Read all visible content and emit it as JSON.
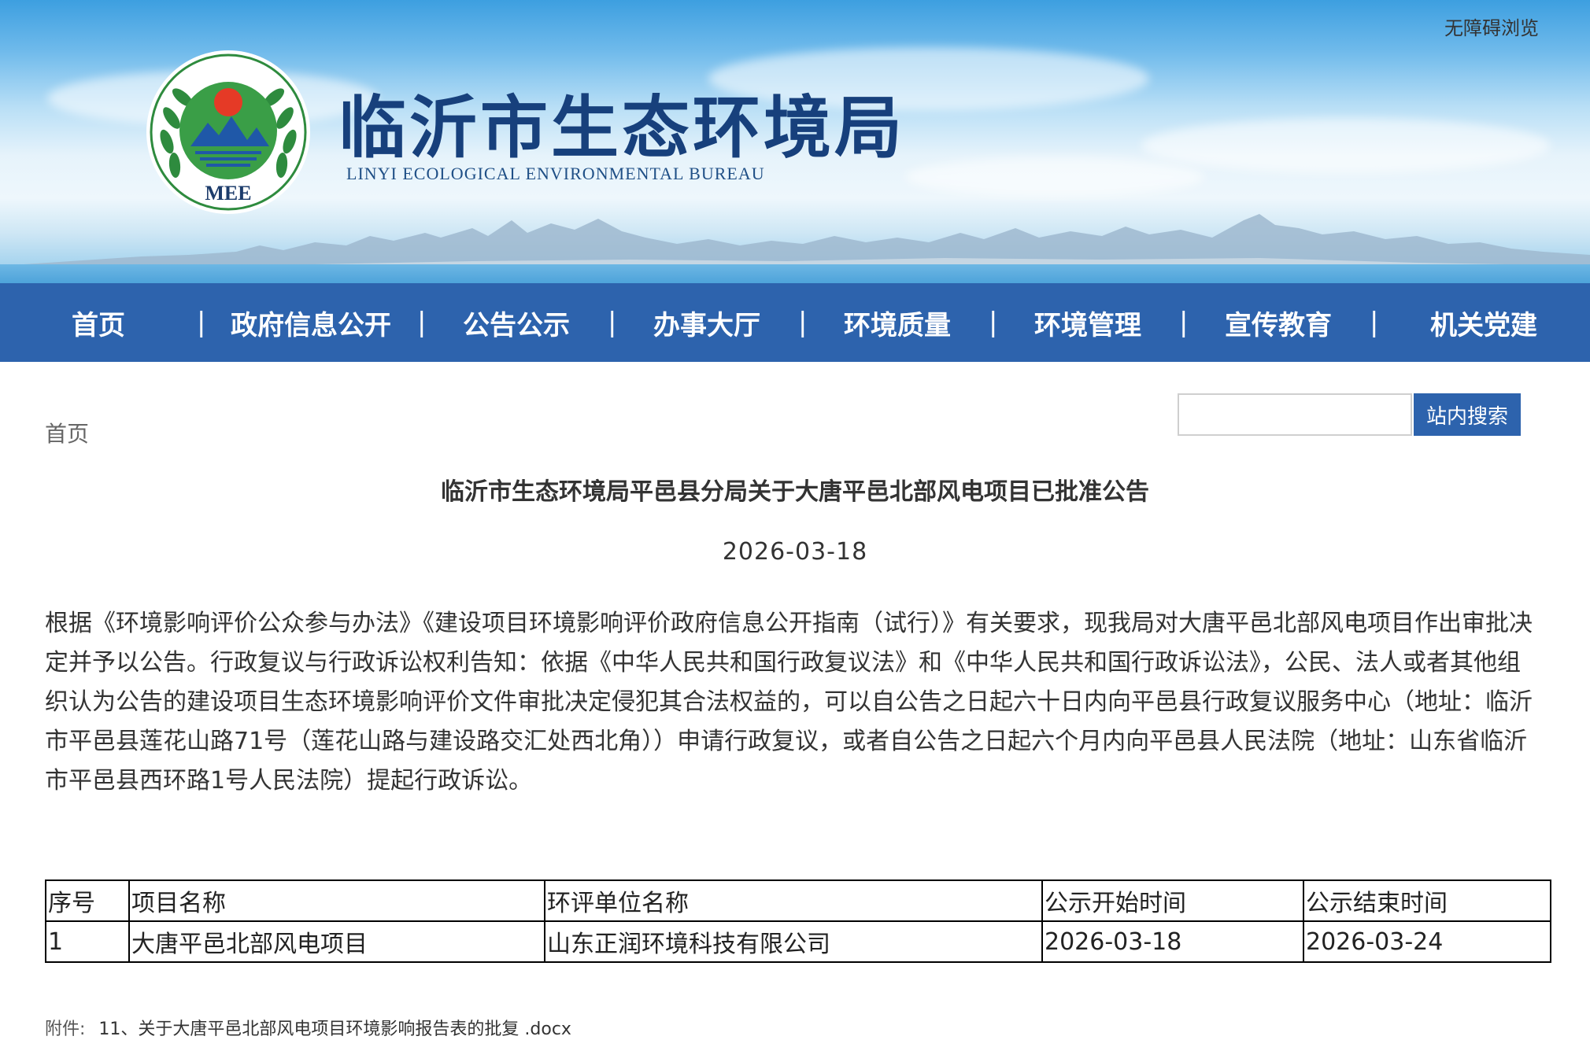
{
  "header": {
    "accessibility_link": "无障碍浏览",
    "site_title": "临沂市生态环境局",
    "site_subtitle": "LINYI ECOLOGICAL ENVIRONMENTAL BUREAU",
    "logo_text": "MEE",
    "colors": {
      "title": "#17407c",
      "nav_bg": "#2d63ad"
    }
  },
  "nav": {
    "items": [
      "首页",
      "政府信息公开",
      "公告公示",
      "办事大厅",
      "环境质量",
      "环境管理",
      "宣传教育",
      "机关党建"
    ],
    "separator": "|"
  },
  "breadcrumb": {
    "home": "首页"
  },
  "search": {
    "placeholder": "",
    "button_label": "站内搜索"
  },
  "article": {
    "title": "临沂市生态环境局平邑县分局关于大唐平邑北部风电项目已批准公告",
    "date": "2026-03-18",
    "body": "根据《环境影响评价公众参与办法》《建设项目环境影响评价政府信息公开指南（试行）》有关要求，现我局对大唐平邑北部风电项目作出审批决定并予以公告。行政复议与行政诉讼权利告知：依据《中华人民共和国行政复议法》和《中华人民共和国行政诉讼法》，公民、法人或者其他组织认为公告的建设项目生态环境影响评价文件审批决定侵犯其合法权益的，可以自公告之日起六十日内向平邑县行政复议服务中心（地址：临沂市平邑县莲花山路71号（莲花山路与建设路交汇处西北角））申请行政复议，或者自公告之日起六个月内向平邑县人民法院（地址：山东省临沂市平邑县西环路1号人民法院）提起行政诉讼。"
  },
  "table": {
    "headers": [
      "序号",
      "项目名称",
      "环评单位名称",
      "公示开始时间",
      "公示结束时间"
    ],
    "rows": [
      [
        "1",
        "大唐平邑北部风电项目",
        "山东正润环境科技有限公司",
        "2026-03-18",
        "2026-03-24"
      ]
    ]
  },
  "attachment": {
    "label": "附件:",
    "file": "11、关于大唐平邑北部风电项目环境影响报告表的批复 .docx"
  }
}
